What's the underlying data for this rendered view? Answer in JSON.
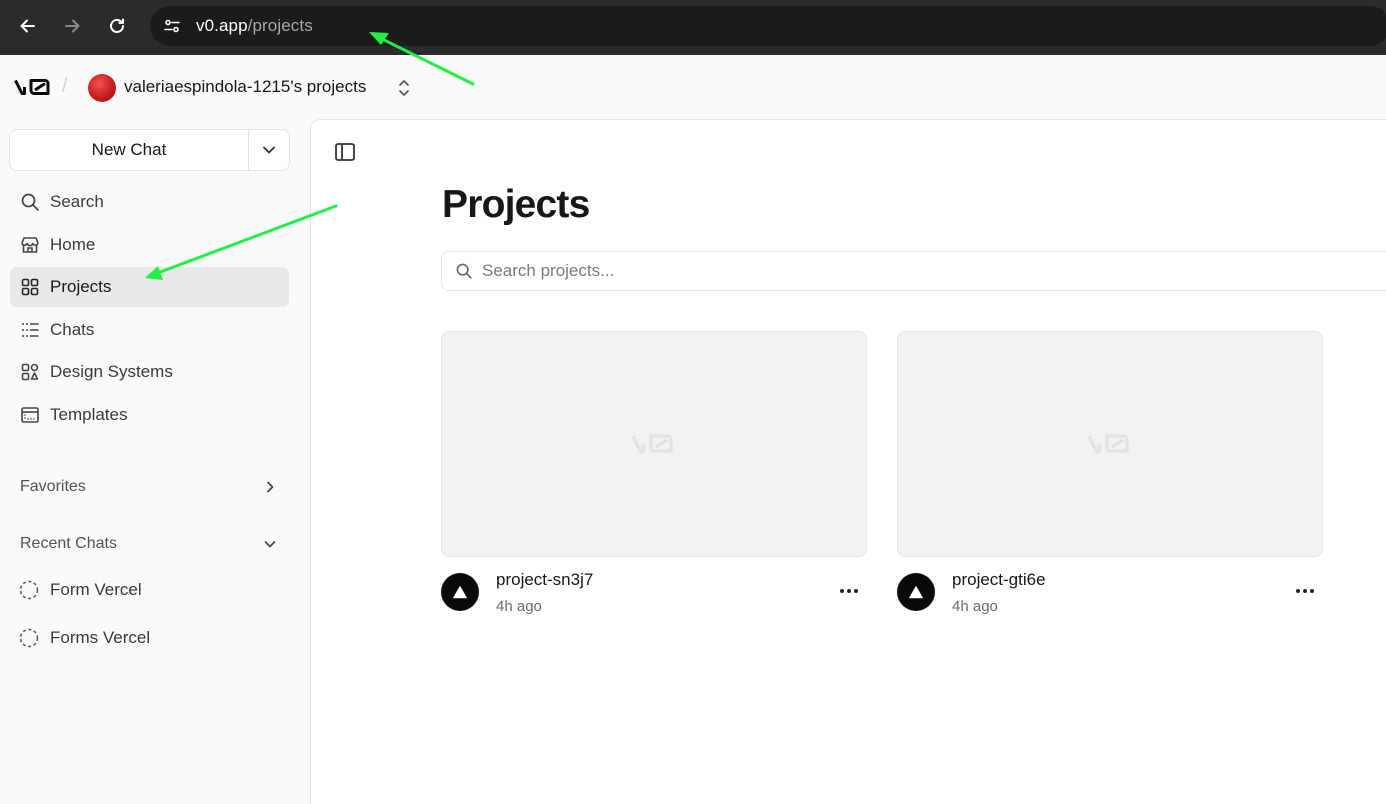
{
  "browser": {
    "url_host": "v0.app",
    "url_path": "/projects"
  },
  "header": {
    "team_name": "valeriaespindola-1215's projects"
  },
  "sidebar": {
    "new_chat_label": "New Chat",
    "items": [
      {
        "label": "Search",
        "icon": "search-icon"
      },
      {
        "label": "Home",
        "icon": "home-icon"
      },
      {
        "label": "Projects",
        "icon": "grid-icon"
      },
      {
        "label": "Chats",
        "icon": "list-icon"
      },
      {
        "label": "Design Systems",
        "icon": "design-systems-icon"
      },
      {
        "label": "Templates",
        "icon": "templates-icon"
      }
    ],
    "favorites_label": "Favorites",
    "recent_label": "Recent Chats",
    "recent_chats": [
      {
        "label": "Form Vercel"
      },
      {
        "label": "Forms Vercel"
      }
    ]
  },
  "main": {
    "title": "Projects",
    "search_placeholder": "Search projects...",
    "projects": [
      {
        "name": "project-sn3j7",
        "time": "4h ago"
      },
      {
        "name": "project-gti6e",
        "time": "4h ago"
      }
    ]
  },
  "colors": {
    "accent_active": "#e8e8e8",
    "annotation_arrow": "#22ee44",
    "chrome_bg": "#2b2b2b"
  }
}
